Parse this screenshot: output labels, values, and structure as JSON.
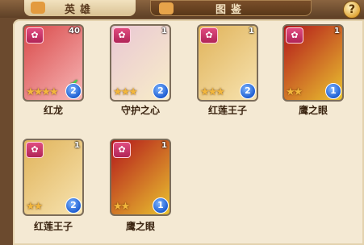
{
  "tabs": [
    {
      "label": "英雄"
    },
    {
      "label": "图鉴"
    }
  ],
  "help_label": "?",
  "cards": [
    {
      "name": "红龙",
      "level": "40",
      "stars": "★★★★",
      "badge": "2",
      "colors": [
        "#d94a4a",
        "#f7b6b6"
      ],
      "checked": true
    },
    {
      "name": "守护之心",
      "level": "1",
      "stars": "★★★",
      "badge": "2",
      "colors": [
        "#e9c7d4",
        "#f8edc8"
      ],
      "checked": false
    },
    {
      "name": "红莲王子",
      "level": "1",
      "stars": "★★★",
      "badge": "2",
      "colors": [
        "#e0b35a",
        "#f7e3b0"
      ],
      "checked": false
    },
    {
      "name": "鹰之眼",
      "level": "1",
      "stars": "★★",
      "badge": "1",
      "colors": [
        "#b3171b",
        "#e9c230"
      ],
      "checked": false
    },
    {
      "name": "红莲王子",
      "level": "1",
      "stars": "★★",
      "badge": "2",
      "colors": [
        "#e0b35a",
        "#f7e3b0"
      ],
      "checked": false
    },
    {
      "name": "鹰之眼",
      "level": "1",
      "stars": "★★",
      "badge": "1",
      "colors": [
        "#b3171b",
        "#e9c230"
      ],
      "checked": false
    }
  ],
  "icons": {
    "element": "lotus-icon",
    "check": "check-icon",
    "badge": "rank-badge"
  }
}
